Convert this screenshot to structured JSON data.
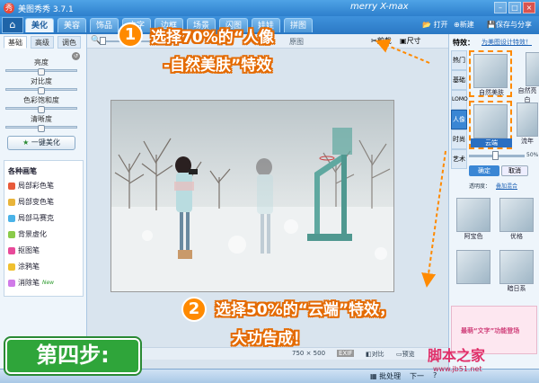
{
  "titlebar": {
    "app_title": "美图秀秀 3.7.1",
    "holiday_text": "merry X-max"
  },
  "nav": {
    "tabs": [
      "美化",
      "美容",
      "饰品",
      "文字",
      "边框",
      "场景",
      "闪图",
      "娃娃",
      "拼图"
    ],
    "open_label": "打开",
    "new_label": "新建",
    "save_label": "保存与分享"
  },
  "left": {
    "subtabs": [
      "基础",
      "高级",
      "调色"
    ],
    "sliders": [
      {
        "label": "亮度",
        "value": 0.5
      },
      {
        "label": "对比度",
        "value": 0.5
      },
      {
        "label": "色彩饱和度",
        "value": 0.5
      },
      {
        "label": "清晰度",
        "value": 0.5
      }
    ],
    "onekey_label": "一键美化",
    "brushes_title": "各种画笔",
    "brushes": [
      "局部彩色笔",
      "局部变色笔",
      "局部马赛克",
      "背景虚化",
      "抠图笔",
      "涂鸦笔",
      "消除笔"
    ],
    "new_badge": "New"
  },
  "canvas": {
    "zoom_hint": "原图",
    "crop_label": "剪裁",
    "size_label": "尺寸",
    "dimensions": "750 × 500",
    "exif": "EXIF",
    "compare_label": "对比",
    "preview_label": "预览"
  },
  "right": {
    "effects_title": "特效：",
    "link_text": "为美图设计特效！",
    "categories": [
      "热门",
      "基础",
      "LOMO",
      "人像",
      "时尚",
      "艺术"
    ],
    "effects_row1": [
      "自然美肤",
      "自然亮白"
    ],
    "effects_row2": [
      "云端",
      "流年"
    ],
    "effects_row3": [
      "阿宝色",
      "优格"
    ],
    "effects_row4": [
      "",
      "暗日系"
    ],
    "opacity_value": "50%",
    "confirm_label": "确定",
    "cancel_label": "取消",
    "fusion_label": "透明度：",
    "fusion_value": "叠加混合"
  },
  "statusbar": {
    "batch_label": "批处理",
    "next_label": "下一",
    "help": "?",
    "version_info": "新"
  },
  "annotations": {
    "step1": "选择70%的“人像",
    "step1b": "-自然美肤”特效",
    "step1_num": "1",
    "step2": "选择50%的“云端”特效，",
    "step2b": "大功告成！",
    "step2_num": "2",
    "step_badge": "第四步:",
    "ad_title": "最萌“文字”功能登场",
    "watermark": "脚本之家",
    "watermark_url": "www.jb51.net"
  }
}
